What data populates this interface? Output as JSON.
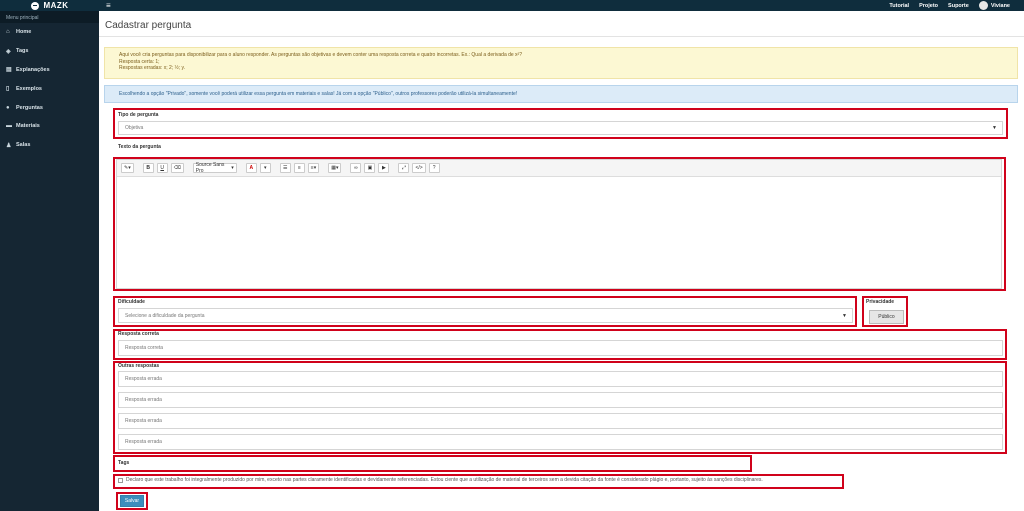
{
  "app": {
    "name": "MAZK"
  },
  "topnav": {
    "tutorial": "Tutorial",
    "projeto": "Projeto",
    "suporte": "Suporte",
    "user": "Viviane"
  },
  "sidebar": {
    "header": "Menu principal",
    "items": [
      {
        "label": "Home",
        "icon": "home-icon"
      },
      {
        "label": "Tags",
        "icon": "tag-icon"
      },
      {
        "label": "Explanações",
        "icon": "book-icon"
      },
      {
        "label": "Exemplos",
        "icon": "file-icon"
      },
      {
        "label": "Perguntas",
        "icon": "question-icon"
      },
      {
        "label": "Materiais",
        "icon": "folder-icon"
      },
      {
        "label": "Salas",
        "icon": "users-icon"
      }
    ]
  },
  "page": {
    "title": "Cadastrar pergunta"
  },
  "alerts": {
    "warning_line1": "Aqui você cria perguntas para disponibilizar para o aluno responder. As perguntas são objetivas e devem conter uma resposta correta e quatro incorretas. Ex.: Qual a derivada de x²?",
    "warning_line2": "Resposta certa: 1;",
    "warning_line3": "Respostas erradas: x; 2; ½; y.",
    "info": "Escolhendo a opção \"Privado\", somente você poderá utilizar essa pergunta em materiais e salas! Já com a opção \"Público\", outros professores poderão utilizá-la simultaneamente!"
  },
  "form": {
    "tipo_label": "Tipo de pergunta",
    "tipo_value": "Objetiva",
    "texto_label": "Texto da pergunta",
    "editor_font": "Source Sans Pro",
    "dificuldade_label": "Dificuldade",
    "dificuldade_placeholder": "Selecione a dificuldade da pergunta",
    "privacidade_label": "Privacidade",
    "privacidade_value": "Público",
    "resposta_correta_label": "Resposta correta",
    "resposta_correta_placeholder": "Resposta correta",
    "outras_label": "Outras respostas",
    "resposta_errada_placeholder": "Resposta errada",
    "tags_label": "Tags",
    "declaro": "Declaro que este trabalho foi integralmente produzido por mim, exceto nas partes claramente identificadas e devidamente referenciadas. Estou ciente que a utilização de material de terceiros sem a devida citação da fonte é considerado plágio e, portanto, sujeito às sanções disciplinares.",
    "salvar": "Salvar"
  },
  "colors": {
    "highlight": "#d0021b",
    "topbar": "#0f2d3d",
    "sidebar": "#152633",
    "primary": "#3c8dbc"
  }
}
